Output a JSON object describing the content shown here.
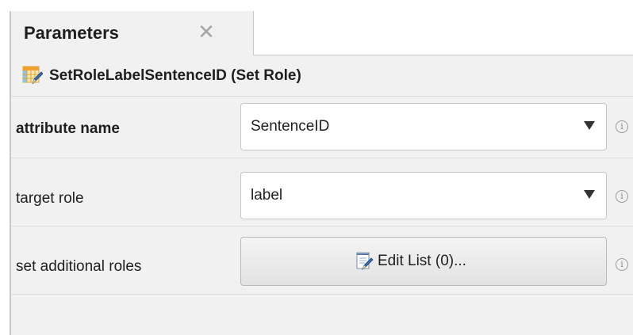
{
  "tab": {
    "title": "Parameters",
    "close_glyph": "✕"
  },
  "operator": {
    "icon": "set-role-icon",
    "title": "SetRoleLabelSentenceID (Set Role)"
  },
  "parameters": [
    {
      "label": "attribute name",
      "type": "select",
      "value": "SentenceID",
      "info_glyph": "i"
    },
    {
      "label": "target role",
      "type": "select",
      "value": "label",
      "info_glyph": "i"
    },
    {
      "label": "set additional roles",
      "type": "button",
      "button_label": "Edit List (0)...",
      "button_icon": "edit-list-icon",
      "info_glyph": "i"
    }
  ],
  "colors": {
    "panel_background": "#f1f1f1",
    "border": "#c9c9c9",
    "text": "#1f1f1f"
  }
}
